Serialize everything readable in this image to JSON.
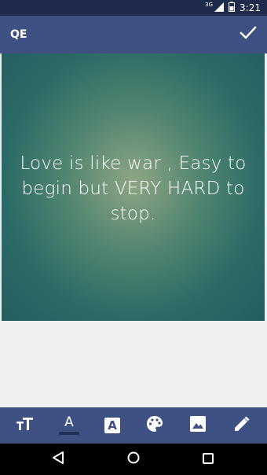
{
  "status_bar": {
    "network_label": "3G",
    "time": "3:21",
    "icons": [
      "signal-icon",
      "battery-icon"
    ]
  },
  "app_bar": {
    "title": "QE",
    "done_icon": "check-icon"
  },
  "canvas": {
    "quote": "Love is like war , Easy to begin but VERY HARD to stop.",
    "background_colors": [
      "#8ea584",
      "#2c6a67",
      "#235e60"
    ],
    "text_color": "#ffffff"
  },
  "toolbar": {
    "items": [
      {
        "icon": "text-size-icon"
      },
      {
        "icon": "text-color-icon",
        "glyph": "A",
        "selected": true
      },
      {
        "icon": "text-background-icon",
        "glyph": "A"
      },
      {
        "icon": "palette-icon"
      },
      {
        "icon": "image-icon"
      },
      {
        "icon": "edit-pencil-icon"
      }
    ]
  },
  "nav_bar": {
    "icons": [
      "back-icon",
      "home-icon",
      "recents-icon"
    ]
  },
  "colors": {
    "status_bar": "#1f2b4d",
    "primary": "#3f5183",
    "page_background": "#efefef",
    "nav_bar": "#000000"
  }
}
